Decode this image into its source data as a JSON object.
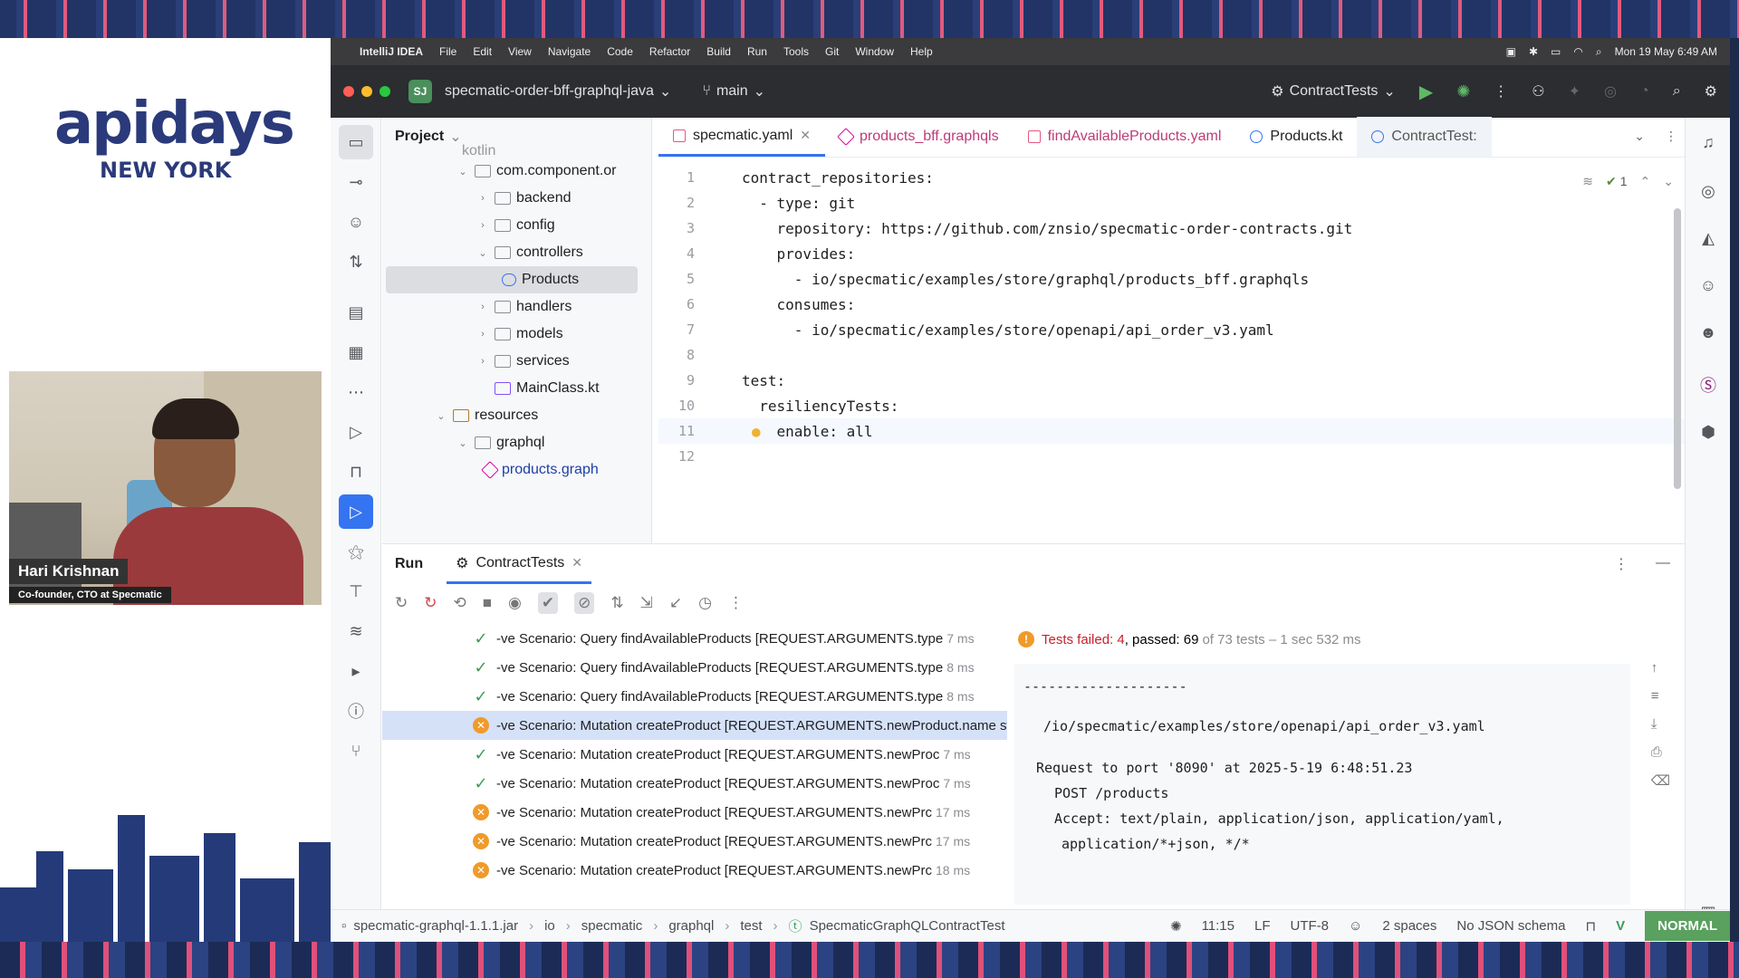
{
  "branding": {
    "logo": "apidays",
    "sub": "NEW YORK"
  },
  "presenter": {
    "name": "Hari Krishnan",
    "title": "Co-founder, CTO at Specmatic"
  },
  "mac_menubar": {
    "app": "IntelliJ IDEA",
    "menus": [
      "File",
      "Edit",
      "View",
      "Navigate",
      "Code",
      "Refactor",
      "Build",
      "Run",
      "Tools",
      "Git",
      "Window",
      "Help"
    ],
    "clock": "Mon 19 May  6:49 AM"
  },
  "titlebar": {
    "project_badge": "SJ",
    "project_name": "specmatic-order-bff-graphql-java",
    "branch": "main",
    "run_config": "ContractTests"
  },
  "project_panel": {
    "title": "Project",
    "items": [
      {
        "label": "kotlin",
        "icon": "folder-icon"
      },
      {
        "label": "com.component.or",
        "icon": "folder-icon"
      },
      {
        "label": "backend",
        "icon": "folder-icon"
      },
      {
        "label": "config",
        "icon": "folder-icon"
      },
      {
        "label": "controllers",
        "icon": "folder-icon"
      },
      {
        "label": "Products",
        "icon": "class-icon"
      },
      {
        "label": "handlers",
        "icon": "folder-icon"
      },
      {
        "label": "models",
        "icon": "folder-icon"
      },
      {
        "label": "services",
        "icon": "folder-icon"
      },
      {
        "label": "MainClass.kt",
        "icon": "kotlin-file-icon"
      },
      {
        "label": "resources",
        "icon": "resources-folder-icon"
      },
      {
        "label": "graphql",
        "icon": "folder-icon"
      },
      {
        "label": "products.graph",
        "icon": "graphql-file-icon"
      }
    ]
  },
  "editor": {
    "tabs": [
      {
        "label": "specmatic.yaml",
        "active": true
      },
      {
        "label": "products_bff.graphqls"
      },
      {
        "label": "findAvailableProducts.yaml"
      },
      {
        "label": "Products.kt"
      },
      {
        "label": "ContractTest:"
      }
    ],
    "inspection_count": "1",
    "lines": [
      {
        "n": "1",
        "text": "contract_repositories:"
      },
      {
        "n": "2",
        "text": "  - type: git"
      },
      {
        "n": "3",
        "text": "    repository: https://github.com/znsio/specmatic-order-contracts.git"
      },
      {
        "n": "4",
        "text": "    provides:"
      },
      {
        "n": "5",
        "text": "      - io/specmatic/examples/store/graphql/products_bff.graphqls"
      },
      {
        "n": "6",
        "text": "    consumes:"
      },
      {
        "n": "7",
        "text": "      - io/specmatic/examples/store/openapi/api_order_v3.yaml"
      },
      {
        "n": "8",
        "text": ""
      },
      {
        "n": "9",
        "text": "test:"
      },
      {
        "n": "10",
        "text": "  resiliencyTests:"
      },
      {
        "n": "11",
        "text": "    enable: all"
      },
      {
        "n": "12",
        "text": ""
      }
    ]
  },
  "run_panel": {
    "title": "Run",
    "tab": "ContractTests",
    "status_failed": "Tests failed: 4",
    "status_passed": ", passed: 69",
    "status_rest": " of 73 tests – 1 sec 532 ms",
    "tests": [
      {
        "status": "pass",
        "name": "-ve Scenario: Query findAvailableProducts [REQUEST.ARGUMENTS.type",
        "duration": "7 ms"
      },
      {
        "status": "pass",
        "name": "-ve Scenario: Query findAvailableProducts [REQUEST.ARGUMENTS.type",
        "duration": "8 ms"
      },
      {
        "status": "pass",
        "name": "-ve Scenario: Query findAvailableProducts [REQUEST.ARGUMENTS.type",
        "duration": "8 ms"
      },
      {
        "status": "fail",
        "name": "-ve Scenario: Mutation createProduct [REQUEST.ARGUMENTS.newProduct.name string mutated to null, REQUEST.ARGUMENTS.newProduct.type selected gadget from enum] | EX:createI",
        "duration": ""
      },
      {
        "status": "pass",
        "name": "-ve Scenario: Mutation createProduct [REQUEST.ARGUMENTS.newProc",
        "duration": "7 ms"
      },
      {
        "status": "pass",
        "name": "-ve Scenario: Mutation createProduct [REQUEST.ARGUMENTS.newProc",
        "duration": "7 ms"
      },
      {
        "status": "fail",
        "name": "-ve Scenario: Mutation createProduct [REQUEST.ARGUMENTS.newPrc",
        "duration": "17 ms"
      },
      {
        "status": "fail",
        "name": "-ve Scenario: Mutation createProduct [REQUEST.ARGUMENTS.newPrc",
        "duration": "17 ms"
      },
      {
        "status": "fail",
        "name": "-ve Scenario: Mutation createProduct [REQUEST.ARGUMENTS.newPrc",
        "duration": "18 ms"
      }
    ],
    "console": {
      "separator": "--------------------",
      "path": "/io/specmatic/examples/store/openapi/api_order_v3.yaml",
      "request": "Request to port '8090' at 2025-5-19 6:48:51.23",
      "method": "POST /products",
      "accept": "Accept: text/plain, application/json, application/yaml,",
      "accept2": "application/*+json, */*"
    }
  },
  "statusbar": {
    "crumbs": [
      "specmatic-graphql-1.1.1.jar",
      "io",
      "specmatic",
      "graphql",
      "test",
      "SpecmaticGraphQLContractTest"
    ],
    "position": "11:15",
    "line_sep": "LF",
    "encoding": "UTF-8",
    "indent": "2 spaces",
    "schema": "No JSON schema",
    "mode": "NORMAL"
  }
}
